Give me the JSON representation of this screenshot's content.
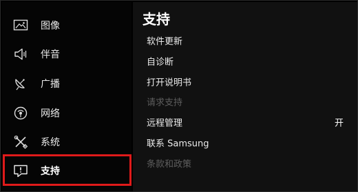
{
  "sidebar": {
    "items": [
      {
        "label": "图像",
        "icon": "picture-icon"
      },
      {
        "label": "伴音",
        "icon": "speaker-icon"
      },
      {
        "label": "广播",
        "icon": "satellite-dish-icon"
      },
      {
        "label": "网络",
        "icon": "network-icon"
      },
      {
        "label": "系统",
        "icon": "tools-icon"
      },
      {
        "label": "支持",
        "icon": "support-icon",
        "selected": true
      }
    ]
  },
  "main": {
    "title": "支持",
    "items": [
      {
        "label": "软件更新",
        "enabled": true
      },
      {
        "label": "自诊断",
        "enabled": true
      },
      {
        "label": "打开说明书",
        "enabled": true
      },
      {
        "label": "请求支持",
        "enabled": false
      },
      {
        "label": "远程管理",
        "enabled": true,
        "value": "开"
      },
      {
        "label": "联系 Samsung",
        "enabled": true
      },
      {
        "label": "条款和政策",
        "enabled": false
      }
    ]
  },
  "colors": {
    "selection_border": "#e01a1a",
    "background": "#000000",
    "disabled_text": "#5e5e5e"
  }
}
